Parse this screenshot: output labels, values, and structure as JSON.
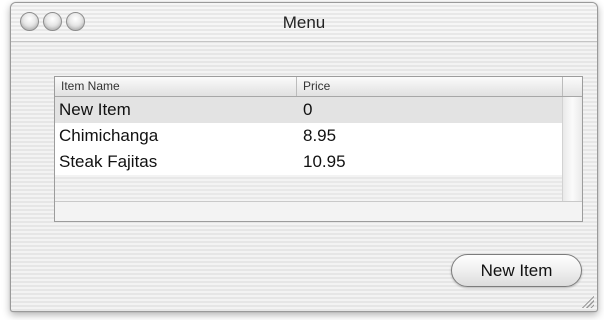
{
  "window": {
    "title": "Menu"
  },
  "titlebar": {
    "buttons": [
      {
        "name": "close",
        "icon": "circle-button-icon"
      },
      {
        "name": "minimize",
        "icon": "circle-button-icon"
      },
      {
        "name": "zoom",
        "icon": "circle-button-icon"
      }
    ]
  },
  "table": {
    "columns": [
      "Item Name",
      "Price"
    ],
    "rows": [
      {
        "name": "New Item",
        "price": "0",
        "selected": true
      },
      {
        "name": "Chimichanga",
        "price": "8.95",
        "selected": false
      },
      {
        "name": "Steak Fajitas",
        "price": "10.95",
        "selected": false
      }
    ]
  },
  "actions": {
    "new_item_label": "New Item"
  },
  "colors": {
    "selected_row": "#e3e3e3",
    "window_stripes": "#ececec"
  }
}
